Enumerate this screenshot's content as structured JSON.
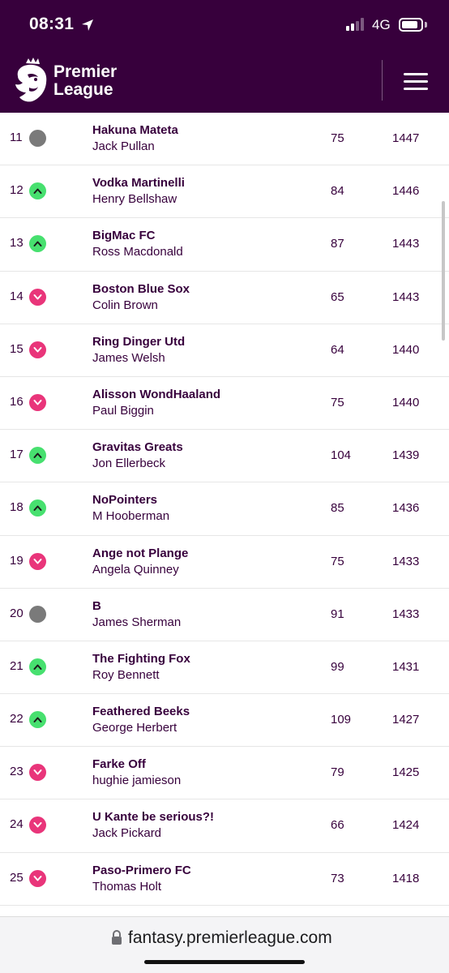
{
  "status_bar": {
    "time": "08:31",
    "network": "4G",
    "battery_level": 0.85
  },
  "header": {
    "brand_line1": "Premier",
    "brand_line2": "League"
  },
  "standings": [
    {
      "rank": "11",
      "movement": "same",
      "team": "Hakuna Mateta",
      "manager": "Jack Pullan",
      "gw": "75",
      "total": "1447"
    },
    {
      "rank": "12",
      "movement": "up",
      "team": "Vodka Martinelli",
      "manager": "Henry Bellshaw",
      "gw": "84",
      "total": "1446"
    },
    {
      "rank": "13",
      "movement": "up",
      "team": "BigMac FC",
      "manager": "Ross Macdonald",
      "gw": "87",
      "total": "1443"
    },
    {
      "rank": "14",
      "movement": "down",
      "team": "Boston Blue Sox",
      "manager": "Colin Brown",
      "gw": "65",
      "total": "1443"
    },
    {
      "rank": "15",
      "movement": "down",
      "team": "Ring Dinger Utd",
      "manager": "James Welsh",
      "gw": "64",
      "total": "1440"
    },
    {
      "rank": "16",
      "movement": "down",
      "team": "Alisson WondHaaland",
      "manager": "Paul Biggin",
      "gw": "75",
      "total": "1440"
    },
    {
      "rank": "17",
      "movement": "up",
      "team": "Gravitas Greats",
      "manager": "Jon Ellerbeck",
      "gw": "104",
      "total": "1439"
    },
    {
      "rank": "18",
      "movement": "up",
      "team": "NoPointers",
      "manager": "M Hooberman",
      "gw": "85",
      "total": "1436"
    },
    {
      "rank": "19",
      "movement": "down",
      "team": "Ange not Plange",
      "manager": "Angela Quinney",
      "gw": "75",
      "total": "1433"
    },
    {
      "rank": "20",
      "movement": "same",
      "team": "B",
      "manager": "James Sherman",
      "gw": "91",
      "total": "1433"
    },
    {
      "rank": "21",
      "movement": "up",
      "team": "The Fighting Fox",
      "manager": "Roy Bennett",
      "gw": "99",
      "total": "1431"
    },
    {
      "rank": "22",
      "movement": "up",
      "team": "Feathered Beeks",
      "manager": "George Herbert",
      "gw": "109",
      "total": "1427"
    },
    {
      "rank": "23",
      "movement": "down",
      "team": "Farke Off",
      "manager": "hughie jamieson",
      "gw": "79",
      "total": "1425"
    },
    {
      "rank": "24",
      "movement": "down",
      "team": "U Kante be serious?!",
      "manager": "Jack Pickard",
      "gw": "66",
      "total": "1424"
    },
    {
      "rank": "25",
      "movement": "down",
      "team": "Paso-Primero FC",
      "manager": "Thomas Holt",
      "gw": "73",
      "total": "1418"
    }
  ],
  "browser": {
    "url": "fantasy.premierleague.com"
  },
  "colors": {
    "brand_purple": "#37003c",
    "up_green": "#47e06f",
    "down_pink": "#e9357a",
    "same_grey": "#7a7a7a"
  }
}
